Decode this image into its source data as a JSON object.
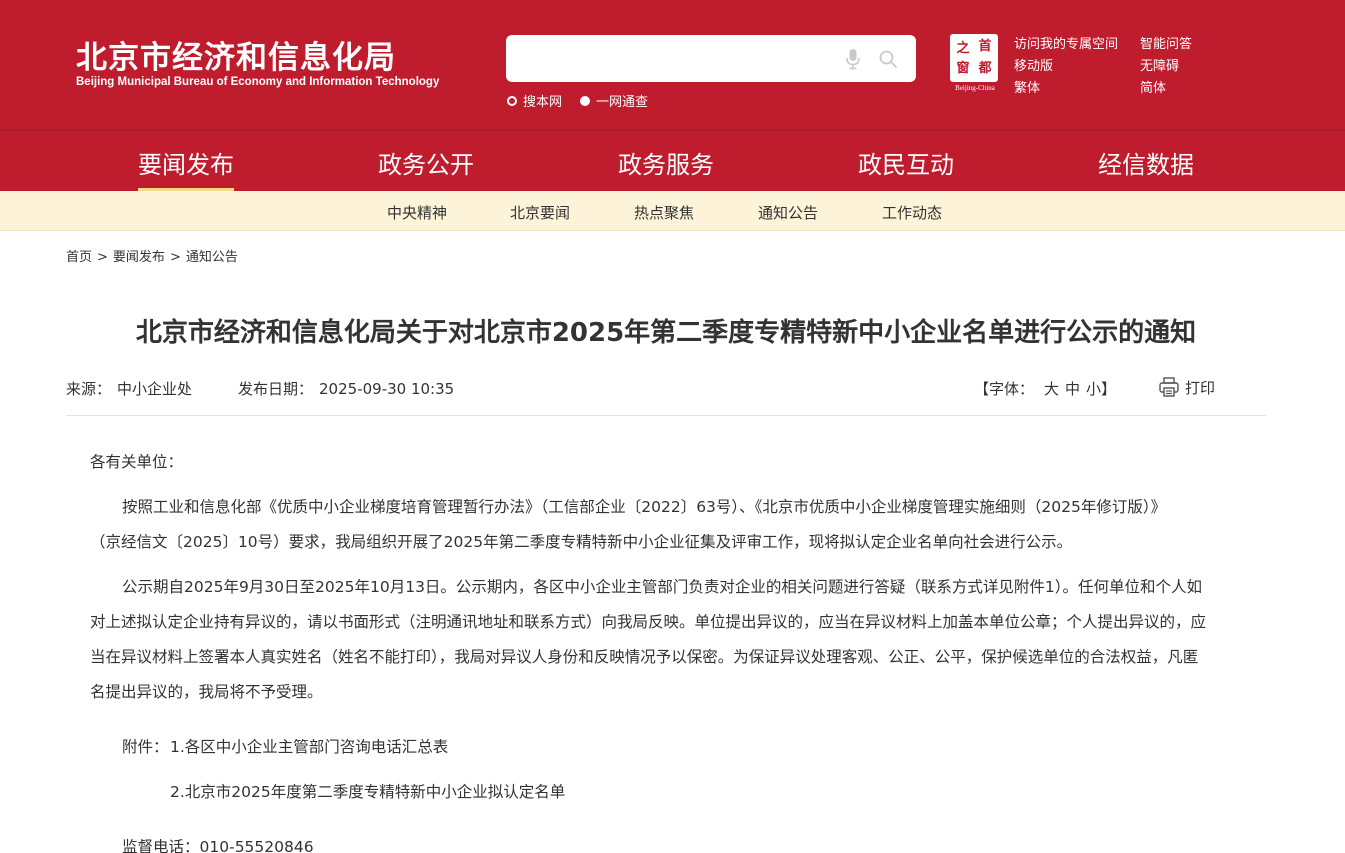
{
  "header": {
    "logo_cn": "北京市经济和信息化局",
    "logo_en": "Beijing Municipal Bureau of Economy and Information Technology",
    "search": {
      "placeholder": "",
      "scope_site": "搜本网",
      "scope_all": "一网通查"
    },
    "seal": {
      "chars": [
        "之",
        "首",
        "窗",
        "都"
      ],
      "caption": "Beijing-China"
    },
    "links": [
      "访问我的专属空间",
      "智能问答",
      "移动版",
      "无障碍",
      "繁体",
      "简体"
    ]
  },
  "main_nav": {
    "items": [
      "要闻发布",
      "政务公开",
      "政务服务",
      "政民互动",
      "经信数据"
    ],
    "active": "要闻发布"
  },
  "sub_nav": {
    "items": [
      "中央精神",
      "北京要闻",
      "热点聚焦",
      "通知公告",
      "工作动态"
    ]
  },
  "breadcrumb": [
    "首页",
    "要闻发布",
    "通知公告"
  ],
  "breadcrumb_sep": ">",
  "article": {
    "title": "北京市经济和信息化局关于对北京市2025年第二季度专精特新中小企业名单进行公示的通知",
    "source_label": "来源：",
    "source": "中小企业处",
    "date_label": "发布日期：",
    "date": "2025-09-30 10:35",
    "font_label": "【字体：",
    "font_options": [
      "大",
      "中",
      "小"
    ],
    "font_close": "】",
    "print_label": "打印",
    "salutation": "各有关单位：",
    "lines": [
      "按照工业和信息化部《优质中小企业梯度培育管理暂行办法》（工信部企业〔2022〕63号）、《北京市优质中小企业梯度管理实施细则（2025年修订版）》",
      "（京经信文〔2025〕10号）要求，我局组织开展了2025年第二季度专精特新中小企业征集及评审工作，现将拟认定企业名单向社会进行公示。",
      "公示期自2025年9月30日至2025年10月13日。公示期内，各区中小企业主管部门负责对企业的相关问题进行答疑（联系方式详见附件1）。任何单位和个人如",
      "对上述拟认定企业持有异议的，请以书面形式（注明通讯地址和联系方式）向我局反映。单位提出异议的，应当在异议材料上加盖本单位公章；个人提出异议的，应",
      "当在异议材料上签署本人真实姓名（姓名不能打印），我局对异议人身份和反映情况予以保密。为保证异议处理客观、公正、公平，保护候选单位的合法权益，凡匿",
      "名提出异议的，我局将不予受理。"
    ],
    "attachments_label": "附件：",
    "attachments": [
      "1.各区中小企业主管部门咨询电话汇总表",
      "2.北京市2025年度第二季度专精特新中小企业拟认定名单"
    ],
    "phone_label": "监督电话：",
    "phone": "010-55520846"
  },
  "colors": {
    "brand_red": "#bf1c2e",
    "subnav_bg": "#fdf3d8",
    "underline": "#f7d98a",
    "text": "#333333"
  },
  "icons": {
    "search": "magnifier-icon",
    "voice": "microphone-icon",
    "print": "printer-icon"
  }
}
